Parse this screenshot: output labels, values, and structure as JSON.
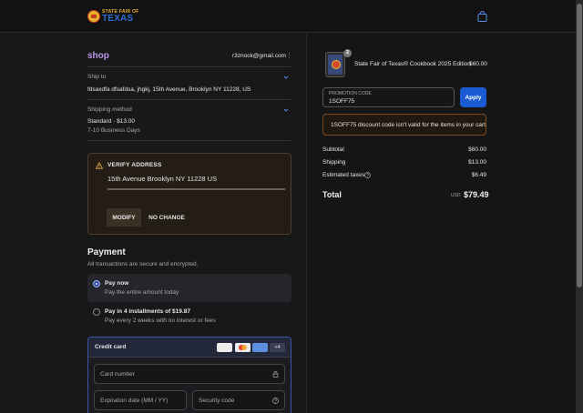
{
  "header": {
    "logo_small": "STATE FAIR OF",
    "logo_big": "TEXAS",
    "bag_icon": "shopping-bag-icon"
  },
  "contact": {
    "shop_label": "shop",
    "email": "r3znock@gmail.com"
  },
  "ship_to": {
    "label": "Ship to",
    "value": "fdsaxdfa dfsafdsa, jhgkj, 15th Avenue, Brooklyn NY 11228, US"
  },
  "shipping_method": {
    "label": "Shipping method",
    "value": "Standard · $13.00",
    "sub": "7-10 Business Days"
  },
  "verify": {
    "title": "VERIFY ADDRESS",
    "address": "15th Avenue Brooklyn NY 11228 US",
    "modify_label": "MODIFY",
    "no_change_label": "NO CHANGE"
  },
  "payment": {
    "title": "Payment",
    "subtitle": "All transactions are secure and encrypted.",
    "options": [
      {
        "title": "Pay now",
        "sub": "Pay the entire amount today",
        "selected": true
      },
      {
        "title": "Pay in 4 installments of $19.87",
        "sub": "Pay every 2 weeks with no interest or fees",
        "selected": false
      }
    ],
    "credit_card": {
      "label": "Credit card",
      "more_cards": "+4",
      "card_number_placeholder": "Card number",
      "expiration_placeholder": "Expiration date (MM / YY)",
      "security_placeholder": "Security code"
    }
  },
  "cart": {
    "item": {
      "name": "State Fair of Texas® Cookbook 2025 Edition",
      "price": "$60.00",
      "quantity": "2"
    },
    "promo": {
      "label": "PROMOTION CODE",
      "value": "1SOFF75",
      "apply_label": "Apply",
      "error": "1SOFF75 discount code isn't valid for the items in your cart"
    },
    "summary": {
      "subtotal_label": "Subtotal",
      "subtotal": "$60.00",
      "shipping_label": "Shipping",
      "shipping": "$13.00",
      "taxes_label": "Estimated taxes",
      "taxes": "$6.49",
      "total_label": "Total",
      "currency": "USD",
      "total": "$79.49"
    }
  },
  "colors": {
    "accent_purple": "#b995e8",
    "apply_blue": "#1a5bd4",
    "error_border": "#7a4a22"
  }
}
